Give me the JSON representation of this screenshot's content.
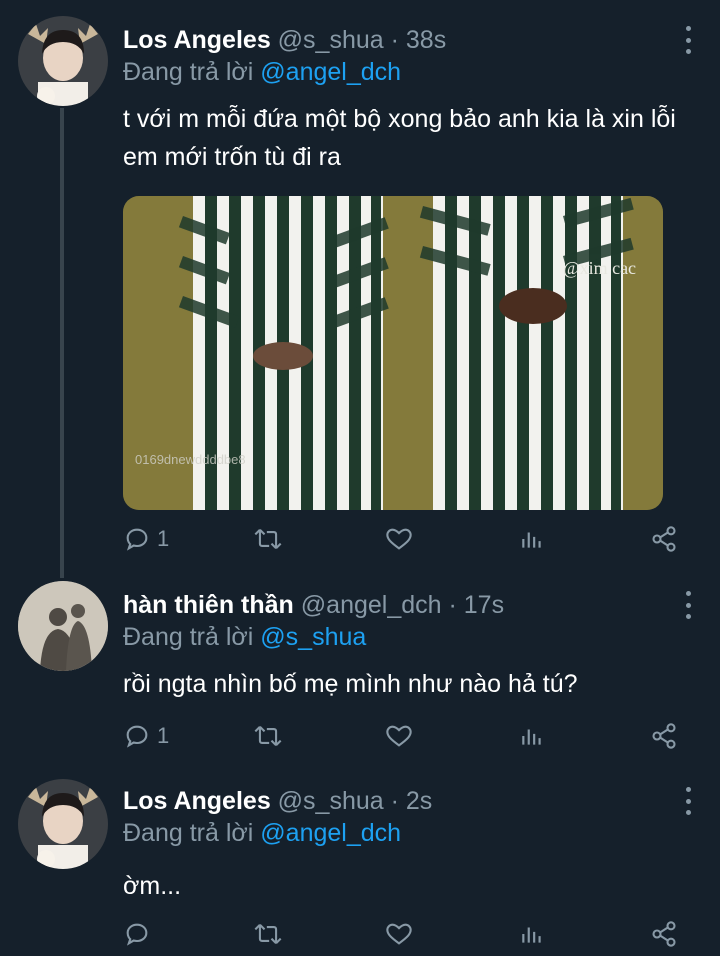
{
  "tweets": [
    {
      "name": "Los Angeles",
      "handle": "@s_shua",
      "dot": "·",
      "time": "38s",
      "reply_prefix": "Đang trả lời",
      "reply_to": "@angel_dch",
      "text": "t với m mỗi đứa một bộ xong bảo anh kia là xin lỗi em mới trốn tù đi ra",
      "media_watermark": "@xim cac",
      "media_watermark_2": "0169dnewddddbe8",
      "reply_count": "1",
      "avatar_icon": "avatar-photo-deer-antlers"
    },
    {
      "name": "hàn thiên thần",
      "handle": "@angel_dch",
      "dot": "·",
      "time": "17s",
      "reply_prefix": "Đang trả lời",
      "reply_to": "@s_shua",
      "text": "rồi ngta nhìn bố mẹ mình như nào hả tú?",
      "reply_count": "1",
      "avatar_icon": "avatar-photo-silhouette"
    },
    {
      "name": "Los Angeles",
      "handle": "@s_shua",
      "dot": "·",
      "time": "2s",
      "reply_prefix": "Đang trả lời",
      "reply_to": "@angel_dch",
      "text": "ờm...",
      "reply_count": "",
      "avatar_icon": "avatar-photo-deer-antlers"
    }
  ],
  "icons": [
    "reply-icon",
    "retweet-icon",
    "like-icon",
    "analytics-icon",
    "share-icon",
    "more-icon"
  ],
  "colors": {
    "background": "#15202b",
    "secondary_text": "#8899a6",
    "mention": "#1da1f2",
    "thread_line": "#38444d"
  }
}
